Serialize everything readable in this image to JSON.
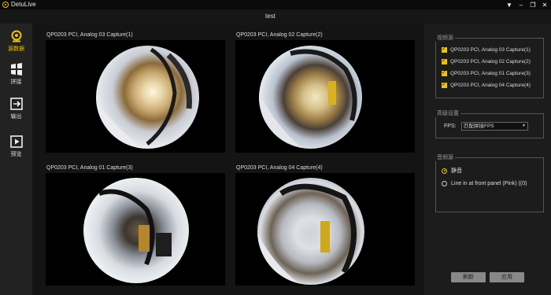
{
  "app": {
    "name": "DetuLive"
  },
  "window_controls": [
    "▼",
    "–",
    "❐",
    "✕"
  ],
  "document": {
    "title": "test"
  },
  "sidebar": {
    "items": [
      {
        "label": "源数据",
        "icon": "webcam-icon",
        "active": true
      },
      {
        "label": "拼接",
        "icon": "grid-icon",
        "active": false
      },
      {
        "label": "输出",
        "icon": "export-icon",
        "active": false
      },
      {
        "label": "预览",
        "icon": "play-icon",
        "active": false
      }
    ]
  },
  "views": [
    {
      "caption": "QP0203 PCI, Analog 03 Capture(1)"
    },
    {
      "caption": "QP0203 PCI, Analog 02 Capture(2)"
    },
    {
      "caption": "QP0203 PCI, Analog 01 Capture(3)"
    },
    {
      "caption": "QP0203 PCI, Analog 04 Capture(4)"
    }
  ],
  "panel": {
    "video_sources": {
      "title": "视频源",
      "items": [
        {
          "label": "QP0203 PCI, Analog 03 Capture(1)",
          "checked": true
        },
        {
          "label": "QP0203 PCI, Analog 02 Capture(2)",
          "checked": true
        },
        {
          "label": "QP0203 PCI, Analog 01 Capture(3)",
          "checked": true
        },
        {
          "label": "QP0203 PCI, Analog 04 Capture(4)",
          "checked": true
        }
      ]
    },
    "advanced": {
      "title": "高级设置",
      "fps_label": "FPS:",
      "fps_value": "匹配拼接FPS"
    },
    "audio_sources": {
      "title": "音频源",
      "options": [
        {
          "label": "静音",
          "selected": true
        },
        {
          "label": "Line in at front panel (Pink) ((0)",
          "selected": false
        }
      ]
    },
    "buttons": {
      "refresh": "刷新",
      "apply": "应用"
    }
  },
  "colors": {
    "accent": "#f2c200",
    "background": "#161616",
    "panel": "#1c1c1c",
    "sidebar": "#222222"
  }
}
